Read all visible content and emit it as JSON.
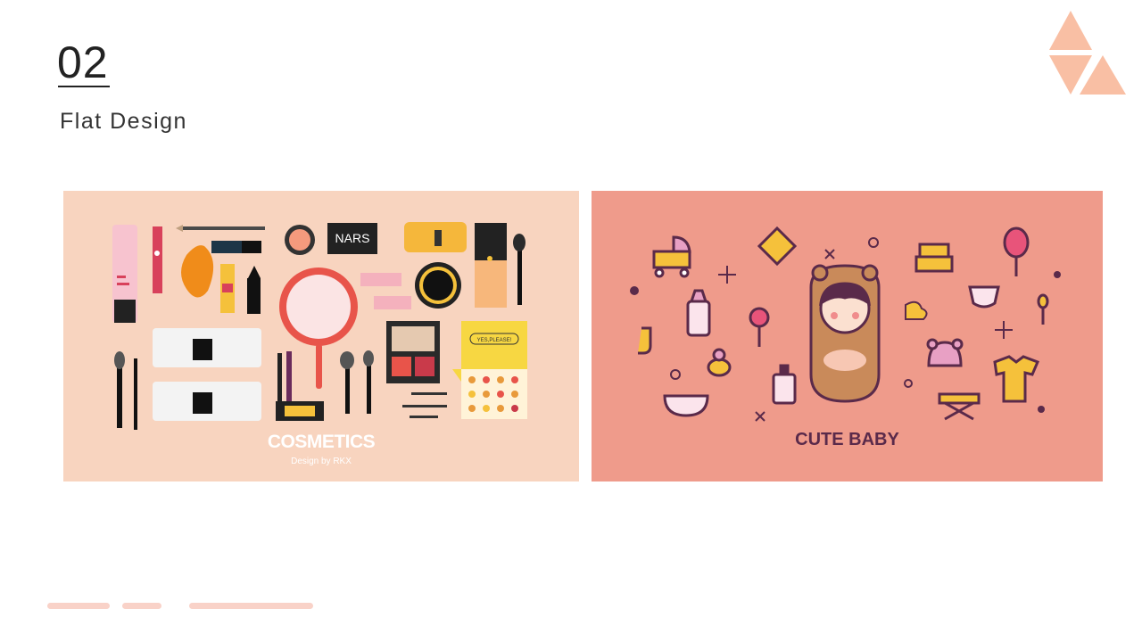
{
  "slide": {
    "number": "02",
    "title": "Flat Design"
  },
  "cards": [
    {
      "title": "COSMETICS",
      "subtitle": "Design by RKX"
    },
    {
      "title": "CUTE BABY"
    }
  ],
  "cosmetics_illustration": {
    "brand_label": "NARS",
    "palette_tag": "YES,PLEASE!"
  },
  "colors": {
    "accent": "#f9bfa4",
    "cosmetics_bg": "#f8d4bf",
    "baby_bg": "#ef9b8b",
    "baby_text": "#5a2a4a",
    "bar": "#f9d2c8"
  }
}
